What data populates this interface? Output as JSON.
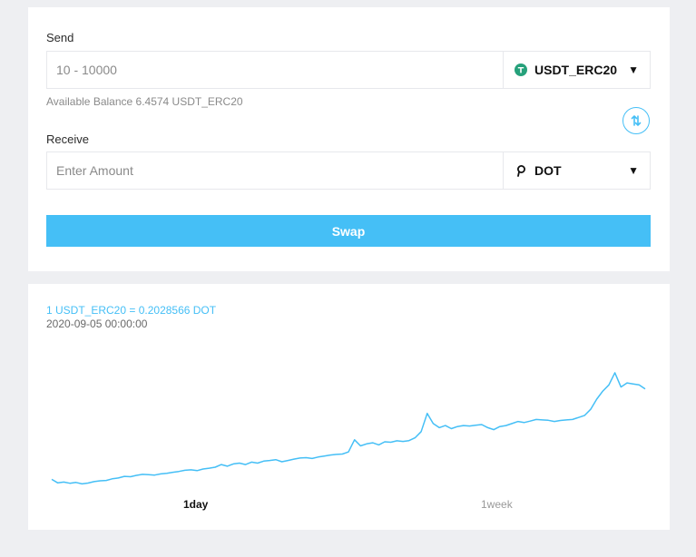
{
  "send": {
    "label": "Send",
    "placeholder": "10 - 10000",
    "currency": "USDT_ERC20",
    "balance_text": "Available Balance 6.4574 USDT_ERC20",
    "coin_color": "#26a17b"
  },
  "receive": {
    "label": "Receive",
    "placeholder": "Enter Amount",
    "currency": "DOT"
  },
  "swap_button_label": "Swap",
  "icons": {
    "swap_direction": "swap-vertical-arrows",
    "dropdown": "caret-down",
    "usdt": "tether-logo",
    "dot": "polkadot-logo"
  },
  "accent_color": "#45bff6",
  "rate_text": "1 USDT_ERC20 = 0.2028566 DOT",
  "date_text": "2020-09-05 00:00:00",
  "ranges": [
    {
      "label": "1day",
      "active": true
    },
    {
      "label": "1week",
      "active": false
    }
  ],
  "chart_data": {
    "type": "line",
    "title": "",
    "xlabel": "",
    "ylabel": "",
    "grid": false,
    "legend": "none",
    "x_axis_labels": false,
    "y_axis_labels": false,
    "ylim": [
      0.146,
      0.213
    ],
    "series": [
      {
        "color": "#45bff6",
        "values": [
          0.1525,
          0.1508,
          0.1512,
          0.1506,
          0.151,
          0.1503,
          0.1507,
          0.1514,
          0.1518,
          0.152,
          0.1528,
          0.1532,
          0.154,
          0.1538,
          0.1545,
          0.155,
          0.1548,
          0.1546,
          0.1552,
          0.1555,
          0.156,
          0.1564,
          0.157,
          0.1572,
          0.1568,
          0.1576,
          0.158,
          0.1585,
          0.1598,
          0.159,
          0.1601,
          0.1605,
          0.1598,
          0.161,
          0.1605,
          0.1615,
          0.1618,
          0.1622,
          0.1612,
          0.1618,
          0.1625,
          0.163,
          0.1632,
          0.1628,
          0.1635,
          0.164,
          0.1645,
          0.1648,
          0.165,
          0.166,
          0.172,
          0.169,
          0.17,
          0.1705,
          0.1695,
          0.171,
          0.1708,
          0.1715,
          0.1712,
          0.1716,
          0.173,
          0.176,
          0.185,
          0.18,
          0.178,
          0.179,
          0.1775,
          0.1785,
          0.179,
          0.1788,
          0.1792,
          0.1795,
          0.178,
          0.177,
          0.1785,
          0.179,
          0.18,
          0.181,
          0.1805,
          0.1812,
          0.182,
          0.1818,
          0.1816,
          0.181,
          0.1815,
          0.1818,
          0.182,
          0.183,
          0.184,
          0.187,
          0.192,
          0.196,
          0.199,
          0.205,
          0.198,
          0.2,
          0.1995,
          0.199,
          0.197
        ]
      }
    ]
  }
}
